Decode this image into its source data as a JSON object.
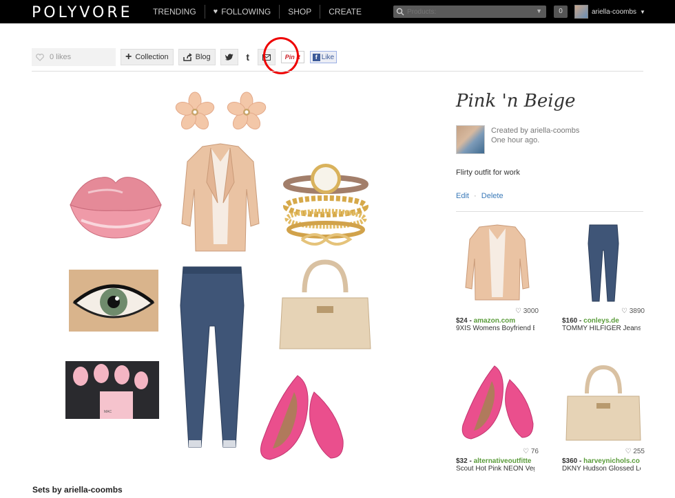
{
  "nav": {
    "logo": "POLYVORE",
    "items": [
      "TRENDING",
      "FOLLOWING",
      "SHOP",
      "CREATE"
    ],
    "search_placeholder": "Products:",
    "counter": "0",
    "username": "ariella-coombs"
  },
  "actions": {
    "likes": "0 likes",
    "collection": "Collection",
    "blog": "Blog",
    "twitter": "t",
    "tumblr": "t",
    "pin": "Pin it",
    "like": "Like"
  },
  "set": {
    "title": "Pink 'n Beige",
    "created_by": "Created by ariella-coombs",
    "time": "One hour ago.",
    "description": "Flirty outfit for work",
    "edit": "Edit",
    "sep": "·",
    "delete": "Delete"
  },
  "products": [
    {
      "likes": "3000",
      "price": "$24",
      "store": "amazon.com",
      "name": "9XIS Womens Boyfriend E"
    },
    {
      "likes": "3890",
      "price": "$160",
      "store": "conleys.de",
      "name": "TOMMY HILFIGER Jeans"
    },
    {
      "likes": "76",
      "price": "$32",
      "store": "alternativeoutfitte",
      "name": "Scout Hot Pink NEON Veg"
    },
    {
      "likes": "255",
      "price": "$360",
      "store": "harveynichols.co",
      "name": "DKNY Hudson Glossed Le"
    }
  ],
  "footer": {
    "sets_by": "Sets by ariella-coombs"
  },
  "colors": {
    "accent_link": "#3a79b8",
    "store_green": "#5a9c3a",
    "highlight_circle": "#e00000"
  }
}
